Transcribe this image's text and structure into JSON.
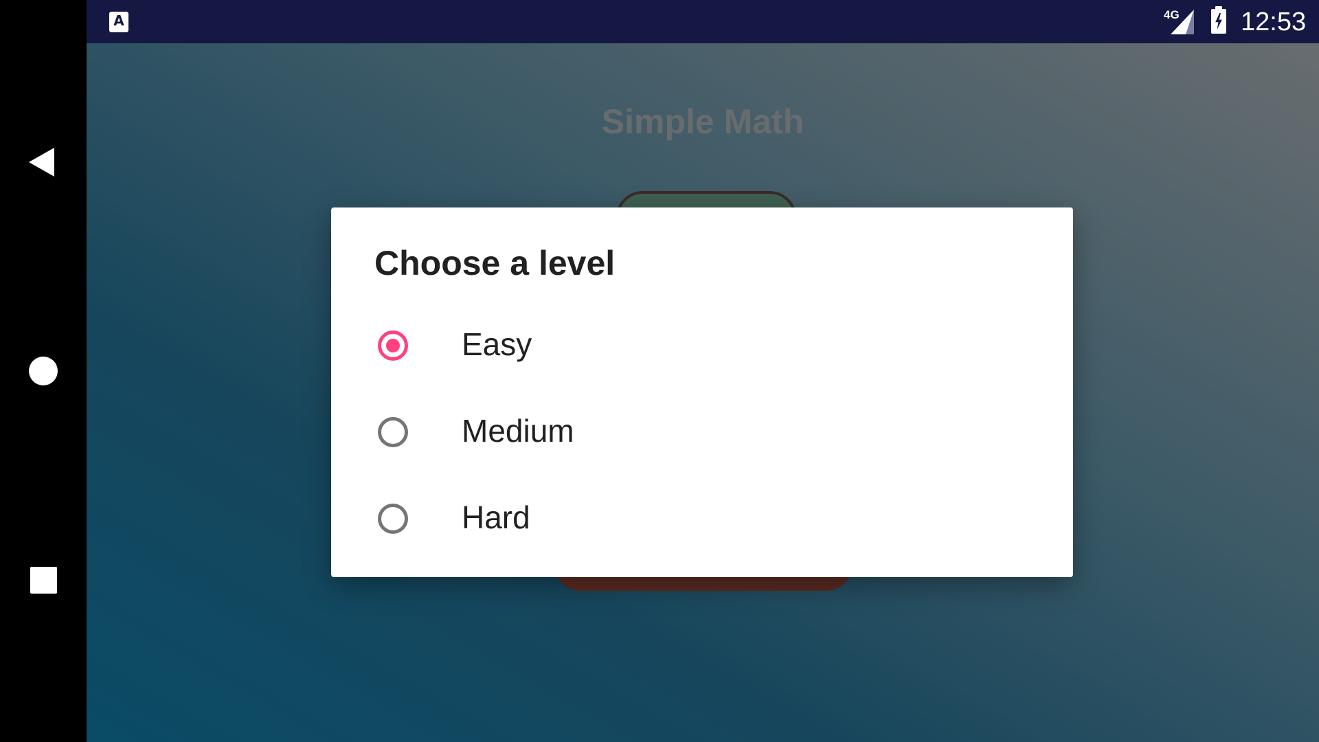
{
  "status_bar": {
    "network": "4G",
    "time": "12:53",
    "notification_icon": "A"
  },
  "app": {
    "title": "Simple Math"
  },
  "dialog": {
    "title": "Choose a level",
    "options": [
      {
        "label": "Easy",
        "selected": true
      },
      {
        "label": "Medium",
        "selected": false
      },
      {
        "label": "Hard",
        "selected": false
      }
    ]
  },
  "colors": {
    "accent": "#ff4081",
    "status_bar": "#141842"
  },
  "nav_icons": [
    "back-icon",
    "home-icon",
    "recents-icon"
  ]
}
